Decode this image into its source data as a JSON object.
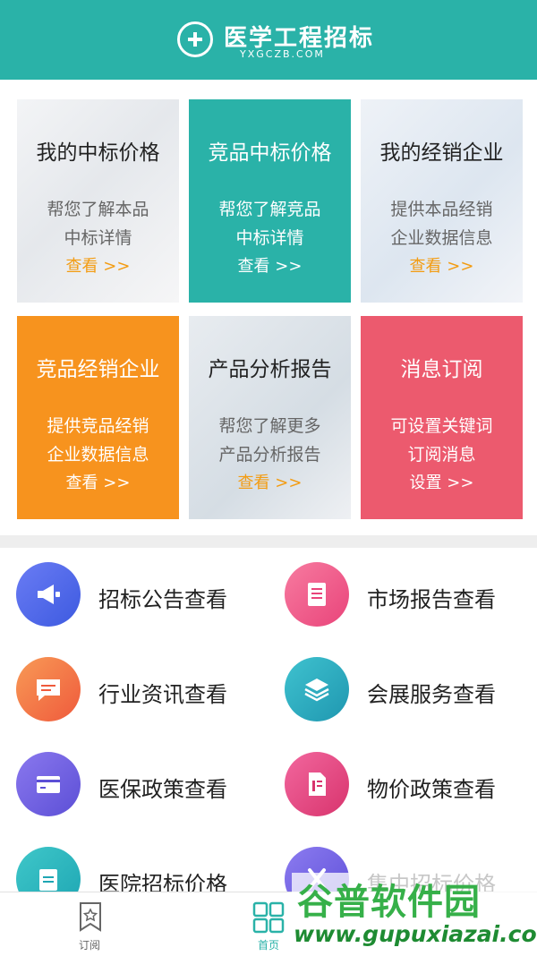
{
  "header": {
    "title": "医学工程招标",
    "subtitle": "YXGCZB.COM"
  },
  "cards": [
    {
      "title": "我的中标价格",
      "line1": "帮您了解本品",
      "line2": "中标详情",
      "link": "查看 >>"
    },
    {
      "title": "竞品中标价格",
      "line1": "帮您了解竞品",
      "line2": "中标详情",
      "link": "查看 >>"
    },
    {
      "title": "我的经销企业",
      "line1": "提供本品经销",
      "line2": "企业数据信息",
      "link": "查看 >>"
    },
    {
      "title": "竞品经销企业",
      "line1": "提供竞品经销",
      "line2": "企业数据信息",
      "link": "查看 >>"
    },
    {
      "title": "产品分析报告",
      "line1": "帮您了解更多",
      "line2": "产品分析报告",
      "link": "查看 >>"
    },
    {
      "title": "消息订阅",
      "line1": "可设置关键词",
      "line2": "订阅消息",
      "link": "设置 >>"
    }
  ],
  "menu": [
    {
      "label": "招标公告查看",
      "icon": "megaphone-icon"
    },
    {
      "label": "市场报告查看",
      "icon": "document-icon"
    },
    {
      "label": "行业资讯查看",
      "icon": "chat-icon"
    },
    {
      "label": "会展服务查看",
      "icon": "layers-icon"
    },
    {
      "label": "医保政策查看",
      "icon": "card-icon"
    },
    {
      "label": "物价政策查看",
      "icon": "file-icon"
    },
    {
      "label": "医院招标价格",
      "icon": "list-icon"
    },
    {
      "label": "集中招标价格",
      "icon": "x-icon"
    }
  ],
  "tabbar": {
    "tab1": "订阅",
    "tab2": "首页"
  },
  "watermark": {
    "main": "谷普软件园",
    "url": "www.gupuxiazai.com"
  },
  "colors": {
    "teal": "#2ab2a8",
    "orange": "#f7931e",
    "pink": "#ec5a6e",
    "link_orange": "#f39c12"
  }
}
